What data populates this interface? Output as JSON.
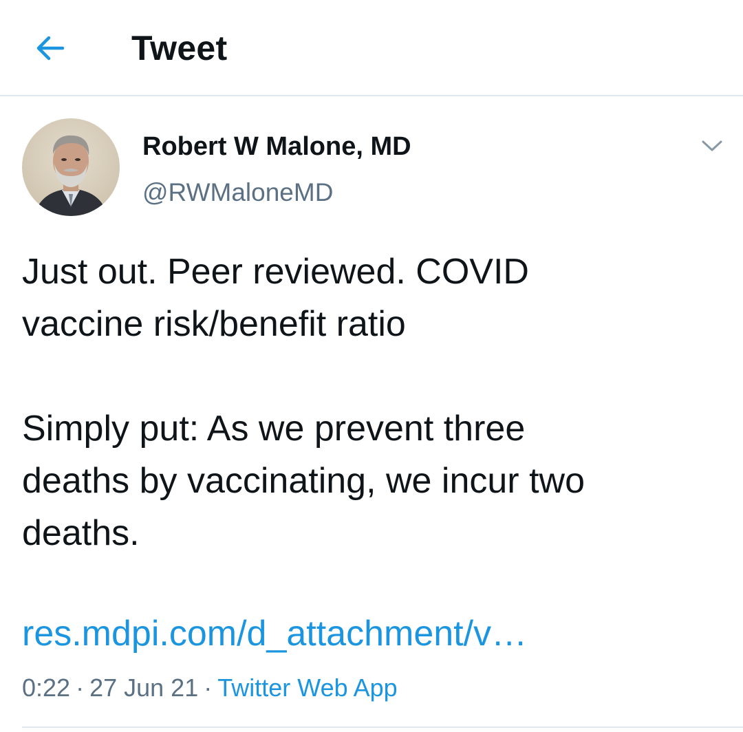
{
  "header": {
    "title": "Tweet",
    "back_icon": "arrow-left-icon"
  },
  "tweet": {
    "author": {
      "display_name": "Robert W Malone, MD",
      "handle": "@RWMaloneMD",
      "avatar_icon": "profile-photo"
    },
    "more_icon": "chevron-down-icon",
    "text_paragraphs": [
      "Just out.  Peer reviewed.  COVID\nvaccine risk/benefit ratio",
      "Simply put: As we prevent three\ndeaths by vaccinating, we incur two\ndeaths."
    ],
    "link": "res.mdpi.com/d_attachment/v…",
    "time": "0:22",
    "date": "27 Jun 21",
    "source": "Twitter Web App",
    "separator": "·"
  },
  "colors": {
    "accent": "#1b95e0",
    "text": "#0f1419",
    "secondary": "#5b7083",
    "divider": "#e1e8ed"
  }
}
